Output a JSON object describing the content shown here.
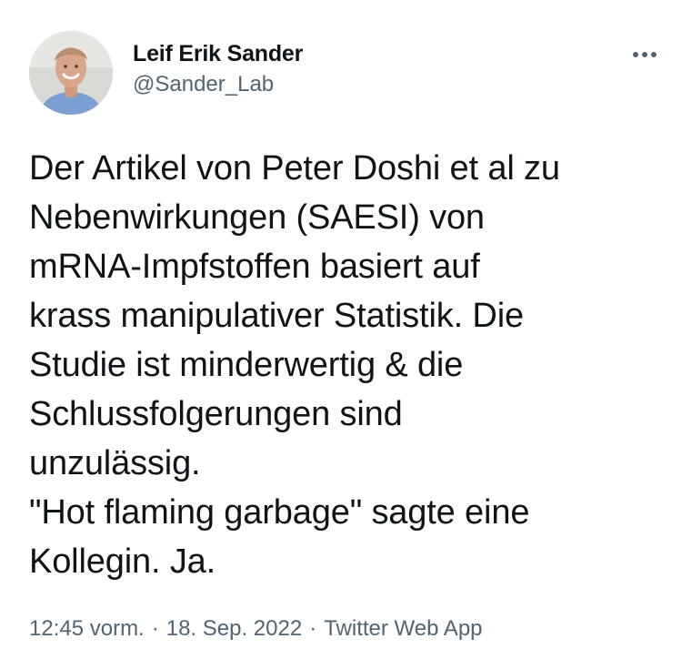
{
  "tweet": {
    "author": {
      "display_name": "Leif Erik Sander",
      "handle": "@Sander_Lab"
    },
    "more_icon": "more-horizontal-icon",
    "text_lines": [
      "Der Artikel von Peter Doshi et al zu",
      "Nebenwirkungen (SAESI) von",
      "mRNA-Impfstoffen basiert auf",
      "krass manipulativer Statistik. Die",
      "Studie ist minderwertig & die",
      "Schlussfolgerungen sind",
      "unzulässig.",
      "\"Hot flaming garbage\" sagte eine",
      "Kollegin. Ja."
    ],
    "meta": {
      "time": "12:45 vorm.",
      "separator": "·",
      "date": "18. Sep. 2022",
      "source": "Twitter Web App"
    }
  },
  "colors": {
    "text_primary": "#0f1419",
    "text_secondary": "#536471",
    "background": "#ffffff"
  }
}
